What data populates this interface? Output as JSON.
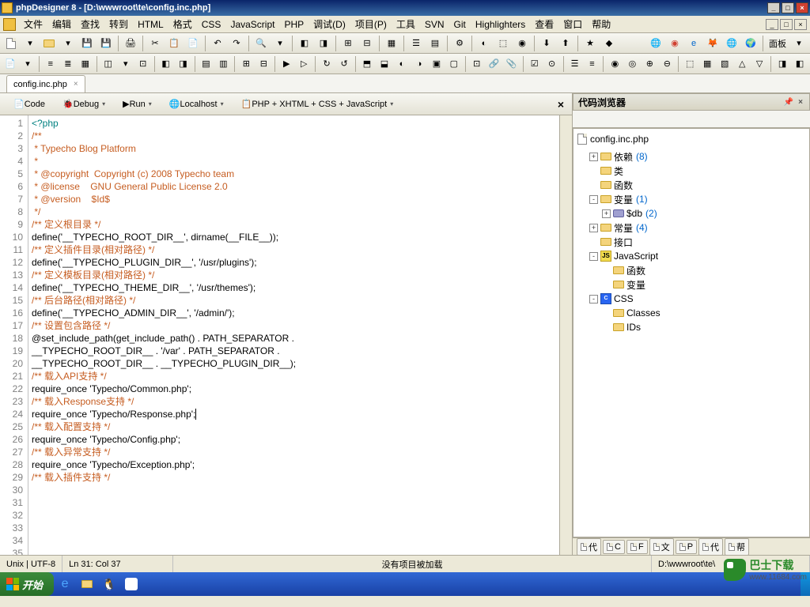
{
  "title": "phpDesigner 8 - [D:\\wwwroot\\te\\config.inc.php]",
  "menu": [
    "文件",
    "编辑",
    "查找",
    "转到",
    "HTML",
    "格式",
    "CSS",
    "JavaScript",
    "PHP",
    "调试(D)",
    "项目(P)",
    "工具",
    "SVN",
    "Git",
    "Highlighters",
    "查看",
    "窗口",
    "帮助"
  ],
  "toolbar_rlabel": "面板",
  "tab": {
    "name": "config.inc.php"
  },
  "secondbar": {
    "code": "Code",
    "debug": "Debug",
    "run": "Run",
    "localhost": "Localhost",
    "langs": "PHP + XHTML + CSS + JavaScript"
  },
  "code_lines": [
    "<?php",
    "/**",
    " * Typecho Blog Platform",
    " *",
    " * @copyright  Copyright (c) 2008 Typecho team",
    " * @license    GNU General Public License 2.0",
    " * @version    $Id$",
    " */",
    "",
    "/** 定义根目录 */",
    "define('__TYPECHO_ROOT_DIR__', dirname(__FILE__));",
    "",
    "/** 定义插件目录(相对路径) */",
    "define('__TYPECHO_PLUGIN_DIR__', '/usr/plugins');",
    "",
    "/** 定义模板目录(相对路径) */",
    "define('__TYPECHO_THEME_DIR__', '/usr/themes');",
    "",
    "/** 后台路径(相对路径) */",
    "define('__TYPECHO_ADMIN_DIR__', '/admin/');",
    "",
    "/** 设置包含路径 */",
    "@set_include_path(get_include_path() . PATH_SEPARATOR .",
    "__TYPECHO_ROOT_DIR__ . '/var' . PATH_SEPARATOR .",
    "__TYPECHO_ROOT_DIR__ . __TYPECHO_PLUGIN_DIR__);",
    "",
    "/** 载入API支持 */",
    "require_once 'Typecho/Common.php';",
    "",
    "/** 载入Response支持 */",
    "require_once 'Typecho/Response.php';",
    "",
    "/** 载入配置支持 */",
    "require_once 'Typecho/Config.php';",
    "",
    "/** 载入异常支持 */",
    "require_once 'Typecho/Exception.php';",
    "",
    "/** 载入插件支持 */"
  ],
  "line_classes": [
    "kw",
    "cmt",
    "cmt",
    "cmt",
    "cmt",
    "cmt",
    "cmt",
    "cmt",
    "",
    "cmt",
    "func",
    "",
    "cmt",
    "func",
    "",
    "cmt",
    "func",
    "",
    "cmt",
    "func",
    "",
    "cmt",
    "func",
    "func",
    "func",
    "",
    "cmt",
    "func",
    "",
    "cmt",
    "func",
    "",
    "cmt",
    "func",
    "",
    "cmt",
    "func",
    "",
    "cmt"
  ],
  "side": {
    "title": "代码浏览器",
    "root": "config.inc.php",
    "items": [
      {
        "label": "依赖",
        "count": "(8)",
        "exp": "+",
        "indent": 1,
        "icon": "folder"
      },
      {
        "label": "类",
        "count": "",
        "exp": "",
        "indent": 1,
        "icon": "folder"
      },
      {
        "label": "函数",
        "count": "",
        "exp": "",
        "indent": 1,
        "icon": "folder"
      },
      {
        "label": "变量",
        "count": "(1)",
        "exp": "-",
        "indent": 1,
        "icon": "folder"
      },
      {
        "label": "$db",
        "count": "(2)",
        "exp": "+",
        "indent": 2,
        "icon": "disk"
      },
      {
        "label": "常量",
        "count": "(4)",
        "exp": "+",
        "indent": 1,
        "icon": "folder"
      },
      {
        "label": "接口",
        "count": "",
        "exp": "",
        "indent": 1,
        "icon": "folder"
      },
      {
        "label": "JavaScript",
        "count": "",
        "exp": "-",
        "indent": 1,
        "icon": "js"
      },
      {
        "label": "函数",
        "count": "",
        "exp": "",
        "indent": 2,
        "icon": "folder"
      },
      {
        "label": "变量",
        "count": "",
        "exp": "",
        "indent": 2,
        "icon": "folder"
      },
      {
        "label": "CSS",
        "count": "",
        "exp": "-",
        "indent": 1,
        "icon": "css"
      },
      {
        "label": "Classes",
        "count": "",
        "exp": "",
        "indent": 2,
        "icon": "folder"
      },
      {
        "label": "IDs",
        "count": "",
        "exp": "",
        "indent": 2,
        "icon": "folder"
      }
    ],
    "footer_tabs": [
      "代",
      "C",
      "F",
      "文",
      "P",
      "代",
      "帮"
    ]
  },
  "status": {
    "encoding": "Unix | UTF-8",
    "pos": "Ln   31: Col  37",
    "center": "没有项目被加载",
    "path": "D:\\wwwroot\\te\\"
  },
  "taskbar": {
    "start": "开始"
  },
  "watermark": {
    "text1": "巴士下载",
    "text2": "www.11684.com"
  }
}
